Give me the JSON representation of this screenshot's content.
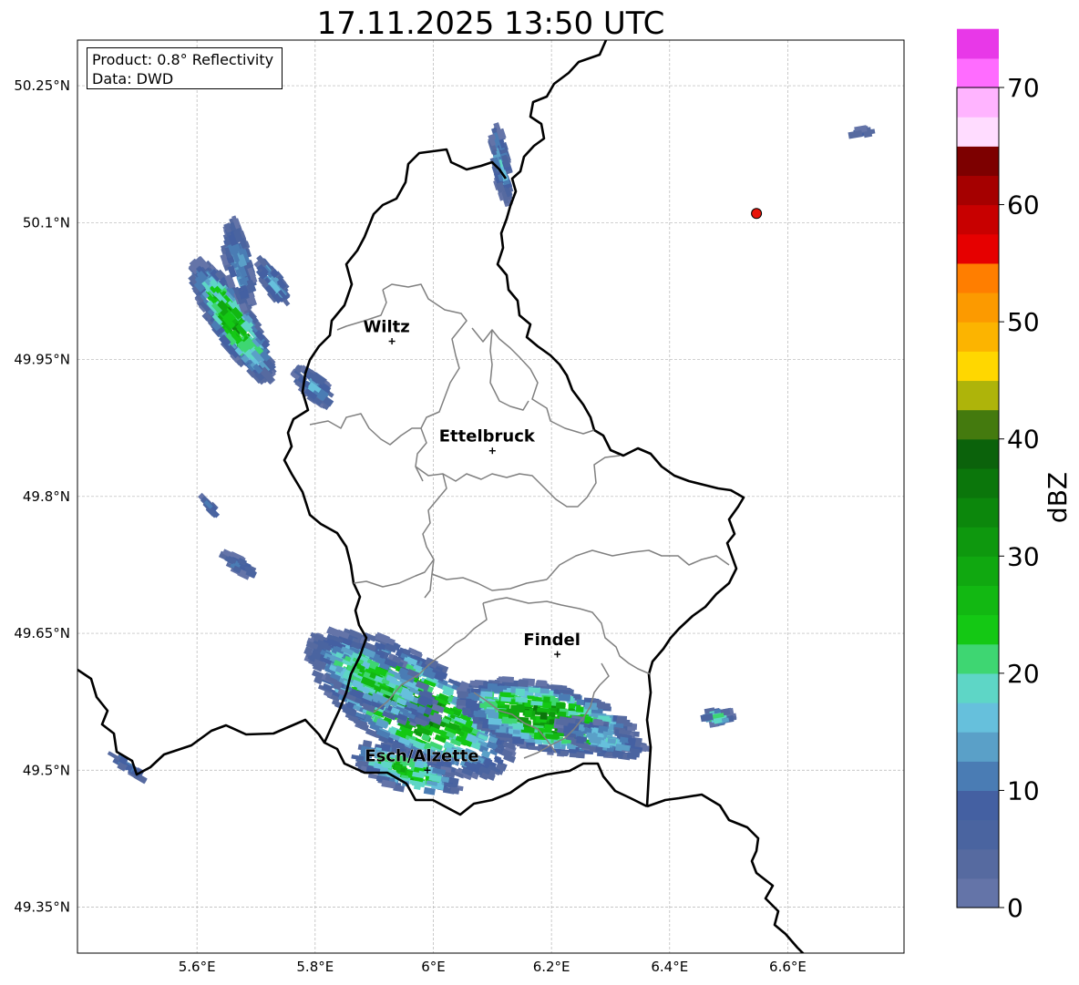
{
  "title": "17.11.2025 13:50 UTC",
  "info": {
    "product": "Product: 0.8° Reflectivity",
    "source": "Data: DWD"
  },
  "map": {
    "lon_range": [
      5.4,
      6.8
    ],
    "lat_range": [
      49.3,
      50.3
    ],
    "lon_ticks": [
      {
        "value": 5.6,
        "label": "5.6°E"
      },
      {
        "value": 5.8,
        "label": "5.8°E"
      },
      {
        "value": 6.0,
        "label": "6°E"
      },
      {
        "value": 6.2,
        "label": "6.2°E"
      },
      {
        "value": 6.4,
        "label": "6.4°E"
      },
      {
        "value": 6.6,
        "label": "6.6°E"
      }
    ],
    "lat_ticks": [
      {
        "value": 50.25,
        "label": "50.25°N"
      },
      {
        "value": 50.1,
        "label": "50.1°N"
      },
      {
        "value": 49.95,
        "label": "49.95°N"
      },
      {
        "value": 49.8,
        "label": "49.8°N"
      },
      {
        "value": 49.65,
        "label": "49.65°N"
      },
      {
        "value": 49.5,
        "label": "49.5°N"
      },
      {
        "value": 49.35,
        "label": "49.35°N"
      }
    ],
    "grid": true,
    "cities": [
      {
        "name": "Wiltz",
        "lon": 5.93,
        "lat": 49.97
      },
      {
        "name": "Ettelbruck",
        "lon": 6.1,
        "lat": 49.85
      },
      {
        "name": "Findel",
        "lon": 6.21,
        "lat": 49.627
      },
      {
        "name": "Esch/Alzette",
        "lon": 5.99,
        "lat": 49.5
      }
    ],
    "marker": {
      "lon": 6.547,
      "lat": 50.11,
      "color": "#e8140a"
    }
  },
  "colorbar": {
    "label": "dBZ",
    "min": 0,
    "max": 70,
    "ticks": [
      0,
      10,
      20,
      30,
      40,
      50,
      60,
      70
    ],
    "step": 2.5,
    "colors": [
      "#6474a8",
      "#566aa0",
      "#4a64a0",
      "#4460a2",
      "#4a7cb4",
      "#5aa0c8",
      "#66c0dc",
      "#5ed6c6",
      "#3ed672",
      "#14c814",
      "#12b812",
      "#10a810",
      "#0e980e",
      "#0c870c",
      "#0b760b",
      "#0b620b",
      "#447a0e",
      "#aeb40a",
      "#ffd700",
      "#fcb400",
      "#fc9a00",
      "#ff7e00",
      "#e60000",
      "#c80000",
      "#a50000",
      "#7d0000",
      "#ffdcff",
      "#ffb4ff",
      "#ff6cff",
      "#e838e8"
    ]
  },
  "chart_data": {
    "type": "heatmap",
    "title": "17.11.2025 13:50 UTC",
    "variable": "0.8° Reflectivity",
    "units": "dBZ",
    "xlim": [
      5.4,
      6.8
    ],
    "ylim": [
      49.3,
      50.3
    ],
    "color_range": [
      0,
      70
    ],
    "echoes": [
      {
        "region": "south cell west",
        "lon_range": [
          5.76,
          6.12
        ],
        "lat_range": [
          49.45,
          49.65
        ],
        "peak_dbz": 30
      },
      {
        "region": "south cell east",
        "lon_range": [
          6.08,
          6.36
        ],
        "lat_range": [
          49.49,
          49.61
        ],
        "peak_dbz": 30
      },
      {
        "region": "northwest band",
        "lon_range": [
          5.55,
          5.86
        ],
        "lat_range": [
          49.88,
          50.1
        ],
        "peak_dbz": 30
      },
      {
        "region": "northern strip",
        "lon_range": [
          6.05,
          6.14
        ],
        "lat_range": [
          50.09,
          50.22
        ],
        "peak_dbz": 15
      },
      {
        "region": "small east cell",
        "lon_range": [
          6.46,
          6.51
        ],
        "lat_range": [
          49.54,
          49.57
        ],
        "peak_dbz": 22
      }
    ]
  }
}
